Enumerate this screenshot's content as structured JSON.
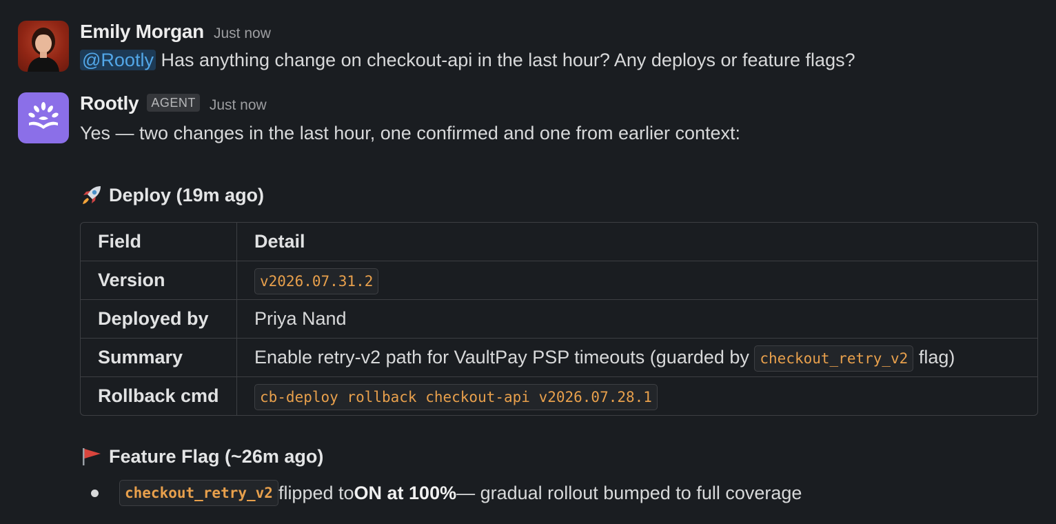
{
  "messages": [
    {
      "sender": "Emily Morgan",
      "timestamp": "Just now",
      "mention": "@Rootly",
      "text": " Has anything change on checkout-api in the last hour? Any deploys or feature flags?"
    },
    {
      "sender": "Rootly",
      "badge": "AGENT",
      "timestamp": "Just now",
      "text": "Yes — two changes in the last hour, one confirmed and one from earlier context:"
    }
  ],
  "deploy": {
    "title": "Deploy (19m ago)",
    "icon": "rocket-icon",
    "table": {
      "headers": [
        "Field",
        "Detail"
      ],
      "rows": [
        {
          "field": "Version",
          "code": "v2026.07.31.2"
        },
        {
          "field": "Deployed by",
          "text": "Priya Nand"
        },
        {
          "field": "Summary",
          "text_before": "Enable retry-v2 path for VaultPay PSP timeouts (guarded by ",
          "code": "checkout_retry_v2",
          "text_after": " flag)"
        },
        {
          "field": "Rollback cmd",
          "code": "cb-deploy rollback checkout-api v2026.07.28.1"
        }
      ]
    }
  },
  "feature_flag": {
    "title": "Feature Flag (~26m ago)",
    "icon": "red-flag-icon",
    "item": {
      "code": "checkout_retry_v2",
      "text_before": " flipped to ",
      "bold": "ON at 100%",
      "text_after": " — gradual rollout bumped to full coverage"
    }
  },
  "colors": {
    "background": "#1a1d21",
    "code_text": "#e8a04c",
    "mention_text": "#52a7e8",
    "rootly_avatar": "#8b6fe8"
  }
}
